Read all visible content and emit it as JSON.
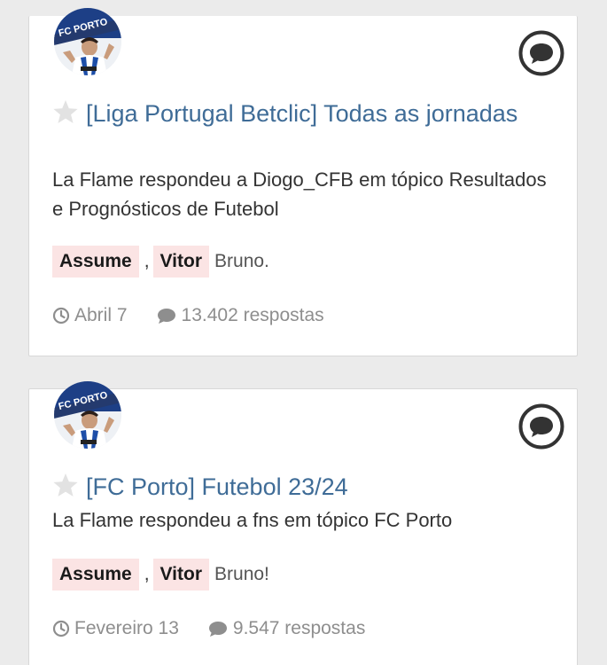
{
  "colors": {
    "title_link": "#3f6c97",
    "tag_bg": "#fbe4e4",
    "meta_text": "#8e8e8e",
    "page_bg": "#ebebeb"
  },
  "avatar": {
    "badge_text": "FC PORTO"
  },
  "topics": [
    {
      "title": "[Liga Portugal Betclic] Todas as jornadas",
      "snippet": "La Flame respondeu a Diogo_CFB em tópico Resultados e Prognósticos de Futebol",
      "tags": [
        "Assume",
        "Vitor"
      ],
      "tag_separator": ",",
      "after_tags": "Bruno.",
      "date": "Abril 7",
      "replies": "13.402 respostas",
      "date_icon": "clock-icon",
      "replies_icon": "comment-icon",
      "star_icon": "star-icon",
      "reply_icon": "chat-bubble-icon"
    },
    {
      "title": "[FC Porto] Futebol 23/24",
      "snippet": "La Flame respondeu a fns em tópico FC Porto",
      "tags": [
        "Assume",
        "Vitor"
      ],
      "tag_separator": ",",
      "after_tags": "Bruno!",
      "date": "Fevereiro 13",
      "replies": "9.547 respostas",
      "date_icon": "clock-icon",
      "replies_icon": "comment-icon",
      "star_icon": "star-icon",
      "reply_icon": "chat-bubble-icon"
    }
  ]
}
